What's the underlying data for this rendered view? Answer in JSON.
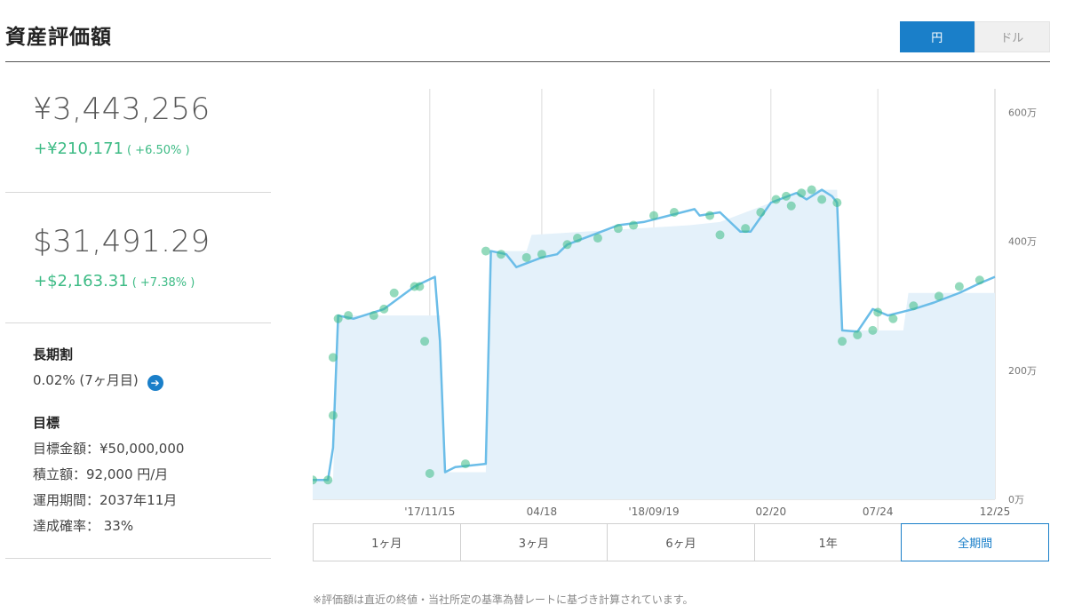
{
  "header": {
    "title": "資産評価額",
    "currency_options": [
      "円",
      "ドル"
    ],
    "selected_currency": "円"
  },
  "summary": {
    "jpy": {
      "value": "¥3,443,256",
      "change": "+¥210,171",
      "change_pct": "( +6.50% )"
    },
    "usd": {
      "value": "$31,491.29",
      "change": "+$2,163.31",
      "change_pct": "( +7.38% )"
    }
  },
  "long_term": {
    "heading": "長期割",
    "value": "0.02% (7ヶ月目)"
  },
  "goal": {
    "heading": "目標",
    "amount": "目標金額：¥50,000,000",
    "contribution": "積立額：92,000 円/月",
    "period": "運用期間：2037年11月",
    "probability": "達成確率： 33%"
  },
  "periods": {
    "items": [
      "1ヶ月",
      "3ヶ月",
      "6ヶ月",
      "1年",
      "全期間"
    ],
    "selected": "全期間"
  },
  "colors": {
    "accent": "#1a7fc9",
    "positive": "#3dbb85",
    "line": "#6bbde8",
    "area": "#e4f1fa"
  },
  "note": "※評価額は直近の終値・当社所定の基準為替レートに基づき計算されています。",
  "chart_data": {
    "type": "area",
    "ylabel": "",
    "y_unit": "万",
    "ylim": [
      0,
      620
    ],
    "y_ticks": [
      0,
      200,
      400,
      600
    ],
    "y_tick_labels": [
      "0万",
      "200万",
      "400万",
      "600万"
    ],
    "x_tick_labels": [
      "'17/11/15",
      "04/18",
      "'18/09/19",
      "02/20",
      "07/24",
      "12/25"
    ],
    "grid": "vertical",
    "series": [
      {
        "values": [
          [
            0,
            30
          ],
          [
            3,
            30
          ],
          [
            4,
            80
          ],
          [
            5,
            285
          ],
          [
            8,
            280
          ],
          [
            14,
            295
          ],
          [
            20,
            330
          ],
          [
            24,
            345
          ],
          [
            25,
            245
          ],
          [
            26,
            42
          ],
          [
            28,
            50
          ],
          [
            34,
            55
          ],
          [
            35,
            385
          ],
          [
            38,
            380
          ],
          [
            40,
            360
          ],
          [
            45,
            375
          ],
          [
            48,
            380
          ],
          [
            50,
            395
          ],
          [
            55,
            410
          ],
          [
            60,
            425
          ],
          [
            65,
            430
          ],
          [
            70,
            440
          ],
          [
            75,
            450
          ],
          [
            76,
            440
          ],
          [
            80,
            445
          ],
          [
            84,
            415
          ],
          [
            86,
            415
          ],
          [
            90,
            460
          ],
          [
            95,
            475
          ],
          [
            97,
            465
          ],
          [
            100,
            480
          ],
          [
            102,
            470
          ],
          [
            103,
            460
          ],
          [
            104,
            262
          ],
          [
            107,
            260
          ],
          [
            110,
            295
          ],
          [
            113,
            285
          ],
          [
            118,
            295
          ],
          [
            122,
            305
          ],
          [
            127,
            320
          ],
          [
            131,
            335
          ],
          [
            134,
            345
          ]
        ],
        "area_values": [
          [
            0,
            30
          ],
          [
            4,
            30
          ],
          [
            5,
            285
          ],
          [
            25,
            285
          ],
          [
            26,
            42
          ],
          [
            34,
            42
          ],
          [
            35,
            385
          ],
          [
            42,
            385
          ],
          [
            43,
            410
          ],
          [
            74,
            425
          ],
          [
            80,
            430
          ],
          [
            90,
            460
          ],
          [
            96,
            480
          ],
          [
            103,
            480
          ],
          [
            104,
            262
          ],
          [
            116,
            262
          ],
          [
            117,
            320
          ],
          [
            131,
            320
          ],
          [
            134,
            320
          ]
        ],
        "markers": [
          [
            0,
            30
          ],
          [
            3,
            30
          ],
          [
            4,
            130
          ],
          [
            4,
            220
          ],
          [
            5,
            280
          ],
          [
            7,
            285
          ],
          [
            12,
            285
          ],
          [
            14,
            295
          ],
          [
            16,
            320
          ],
          [
            20,
            330
          ],
          [
            21,
            330
          ],
          [
            22,
            245
          ],
          [
            23,
            40
          ],
          [
            30,
            55
          ],
          [
            34,
            385
          ],
          [
            37,
            380
          ],
          [
            42,
            375
          ],
          [
            45,
            380
          ],
          [
            50,
            395
          ],
          [
            52,
            405
          ],
          [
            56,
            405
          ],
          [
            60,
            420
          ],
          [
            63,
            425
          ],
          [
            67,
            440
          ],
          [
            71,
            445
          ],
          [
            78,
            440
          ],
          [
            80,
            410
          ],
          [
            85,
            420
          ],
          [
            88,
            445
          ],
          [
            91,
            465
          ],
          [
            93,
            470
          ],
          [
            94,
            455
          ],
          [
            96,
            475
          ],
          [
            98,
            480
          ],
          [
            100,
            465
          ],
          [
            103,
            460
          ],
          [
            104,
            245
          ],
          [
            107,
            255
          ],
          [
            110,
            262
          ],
          [
            111,
            290
          ],
          [
            114,
            280
          ],
          [
            118,
            300
          ],
          [
            123,
            315
          ],
          [
            127,
            330
          ],
          [
            131,
            340
          ]
        ]
      }
    ],
    "x_ticks_at": [
      23,
      45,
      67,
      90,
      111,
      134
    ]
  }
}
